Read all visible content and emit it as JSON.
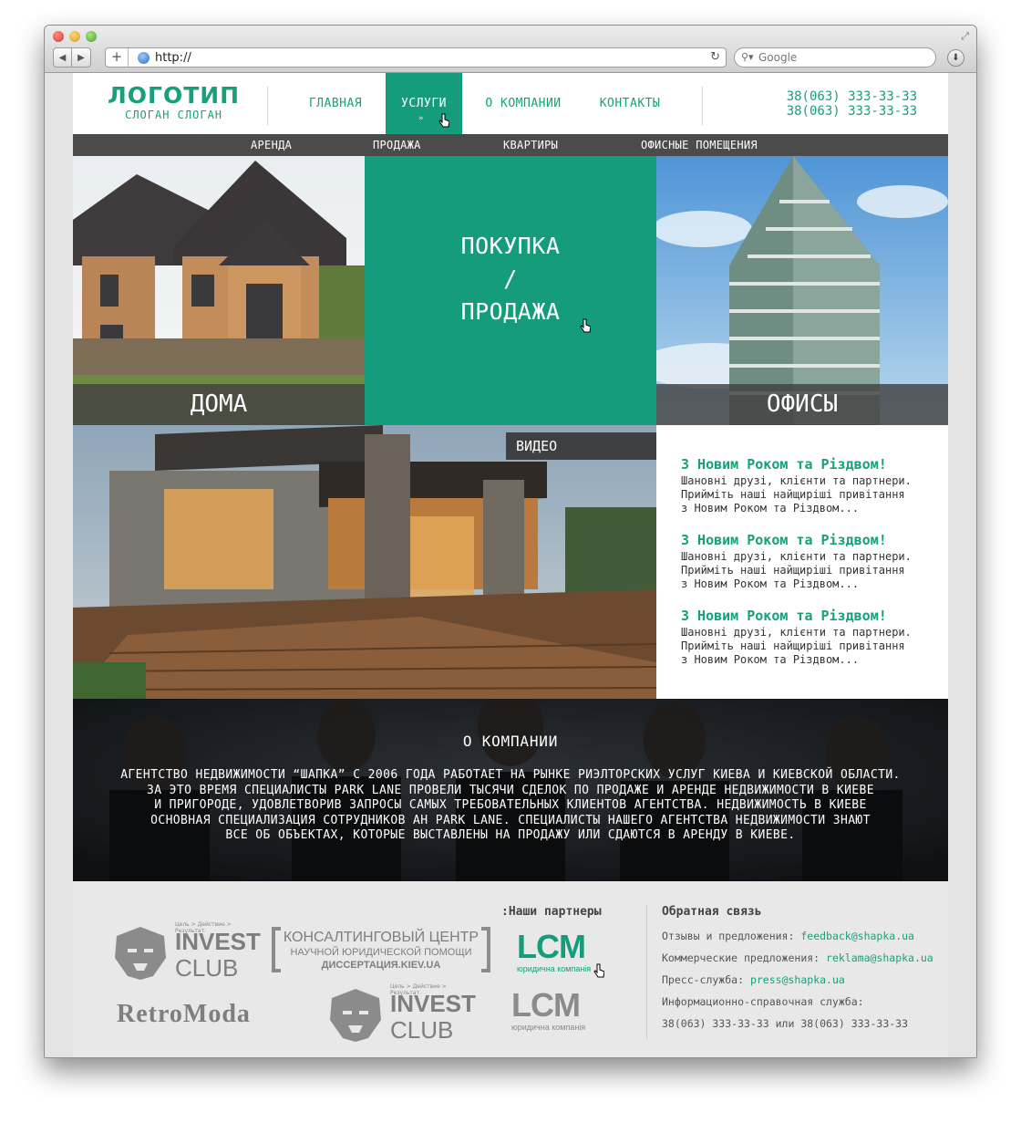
{
  "browser": {
    "url": "http://",
    "search_placeholder": "Google"
  },
  "header": {
    "logo_title": "ЛОГОТИП",
    "logo_slogan": "СЛОГАН СЛОГАН",
    "menu": [
      {
        "label": "ГЛАВНАЯ",
        "active": false
      },
      {
        "label": "УСЛУГИ",
        "active": true
      },
      {
        "label": "О КОМПАНИИ",
        "active": false
      },
      {
        "label": "КОНТАКТЫ",
        "active": false
      }
    ],
    "phones": [
      "38(063) 333-33-33",
      "38(063) 333-33-33"
    ]
  },
  "submenu": [
    "АРЕНДА",
    "ПРОДАЖА",
    "КВАРТИРЫ",
    "ОФИСНЫЕ ПОМЕЩЕНИЯ"
  ],
  "tiles": {
    "houses": "ДОМА",
    "buy_sell": [
      "ПОКУПКА",
      "/",
      "ПРОДАЖА"
    ],
    "offices": "ОФИСЫ",
    "video": "ВИДЕО"
  },
  "news": [
    {
      "title": "З Новим Роком та Різдвом!",
      "lines": [
        "Шановні друзі, клієнти та партнери.",
        "Прийміть наші найщиріші привітання",
        "з Новим Роком та Різдвом..."
      ]
    },
    {
      "title": "З Новим Роком та Різдвом!",
      "lines": [
        "Шановні друзі, клієнти та партнери.",
        "Прийміть наші найщиріші привітання",
        "з Новим Роком та Різдвом..."
      ]
    },
    {
      "title": "З Новим Роком та Різдвом!",
      "lines": [
        "Шановні друзі, клієнти та партнери.",
        "Прийміть наші найщиріші привітання",
        "з Новим Роком та Різдвом..."
      ]
    }
  ],
  "about": {
    "title": "О КОМПАНИИ",
    "lines": [
      "АГЕНТСТВО НЕДВИЖИМОСТИ “ШАПКА” С 2006 ГОДА РАБОТАЕТ НА РЫНКЕ РИЭЛТОРСКИХ УСЛУГ КИЕВА И КИЕВСКОЙ ОБЛАСТИ.",
      "ЗА ЭТО ВРЕМЯ СПЕЦИАЛИСТЫ PARK LANE ПРОВЕЛИ ТЫСЯЧИ СДЕЛОК ПО ПРОДАЖЕ И АРЕНДЕ НЕДВИЖИМОСТИ В КИЕВЕ",
      "И ПРИГОРОДЕ, УДОВЛЕТВОРИВ ЗАПРОСЫ САМЫХ ТРЕБОВАТЕЛЬНЫХ КЛИЕНТОВ АГЕНТСТВА. НЕДВИЖИМОСТЬ В КИЕВЕ",
      "ОСНОВНАЯ СПЕЦИАЛИЗАЦИЯ СОТРУДНИКОВ АН PARK LANE. СПЕЦИАЛИСТЫ НАШЕГО АГЕНТСТВА НЕДВИЖИМОСТИ ЗНАЮТ",
      "ВСЕ ОБ ОБЪЕКТАХ, КОТОРЫЕ ВЫСТАВЛЕНЫ НА ПРОДАЖУ ИЛИ СДАЮТСЯ В АРЕНДУ В КИЕВЕ."
    ]
  },
  "partners": {
    "title": ":Наши партнеры",
    "invest_tag": "Цель > Действие > Результат.",
    "invest_1": "INVEST",
    "invest_2": "CLUB",
    "consult_1": "КОНСАЛТИНГОВЫЙ ЦЕНТР",
    "consult_2": "НАУЧНОЙ ЮРИДИЧЕСКОЙ ПОМОЩИ",
    "consult_3": "ДИССЕРТАЦИЯ.KIEV.UA",
    "lcm": "LCM",
    "lcm_sub": "юридична компанія",
    "retro": "RetroModa"
  },
  "contacts": {
    "title": "Обратная связь",
    "rows": [
      {
        "label": "Отзывы и предложения:",
        "value": "feedback@shapka.ua"
      },
      {
        "label": "Коммерческие предложения:",
        "value": "reklama@shapka.ua"
      },
      {
        "label": "Пресс-служба:",
        "value": "press@shapka.ua"
      }
    ],
    "info_label": "Информационно-справочная служба:",
    "info_value": "38(063) 333-33-33 или 38(063) 333-33-33"
  },
  "colors": {
    "accent": "#159d7b",
    "dark_bar": "#4b4b4b",
    "footer_bg": "#e8e8e8"
  }
}
